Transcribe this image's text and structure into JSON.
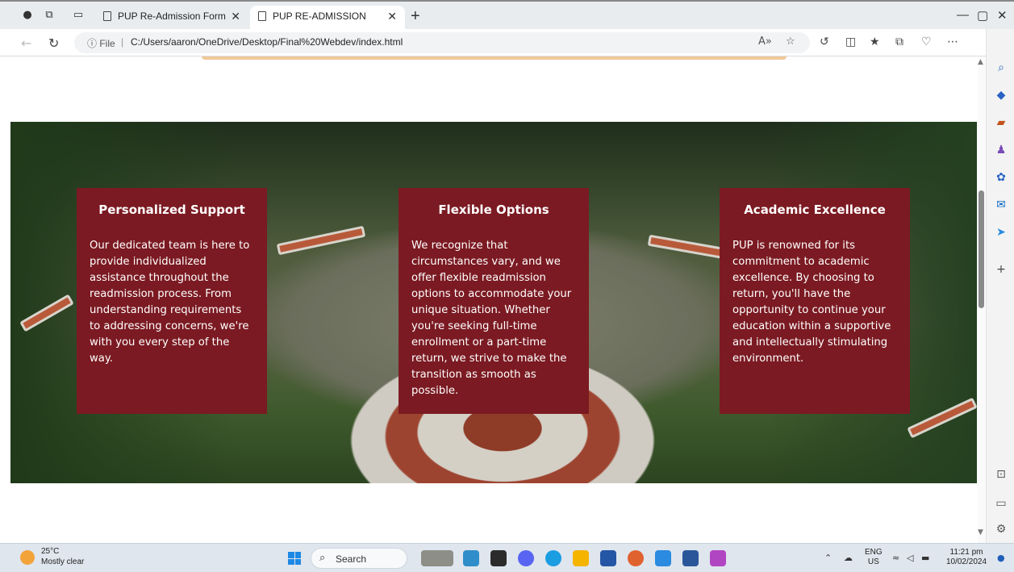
{
  "browser": {
    "tabs": [
      {
        "title": "PUP Re-Admission Form",
        "active": false
      },
      {
        "title": "PUP RE-ADMISSION",
        "active": true
      }
    ],
    "new_tab": "+",
    "address": {
      "info_label": "ⓘ File",
      "separator": "|",
      "url": "C:/Users/aaron/OneDrive/Desktop/Final%20Webdev/index.html"
    },
    "window_controls": {
      "minimize": "—",
      "restore": "▢",
      "close": "✕"
    }
  },
  "page": {
    "cards": [
      {
        "title": "Personalized Support",
        "body": "Our dedicated team is here to provide individualized assistance throughout the readmission process. From understanding requirements to addressing concerns, we're with you every step of the way."
      },
      {
        "title": "Flexible Options",
        "body": "We recognize that circumstances vary, and we offer flexible readmission options to accommodate your unique situation. Whether you're seeking full-time enrollment or a part-time return, we strive to make the transition as smooth as possible."
      },
      {
        "title": "Academic Excellence",
        "body": "PUP is renowned for its commitment to academic excellence. By choosing to return, you'll have the opportunity to continue your education within a supportive and intellectually stimulating environment."
      }
    ],
    "card_color": "#7b1a22"
  },
  "taskbar": {
    "weather": {
      "temp": "25°C",
      "condition": "Mostly clear"
    },
    "search_label": "Search",
    "language": {
      "lang": "ENG",
      "region": "US"
    },
    "clock": {
      "time": "11:21 pm",
      "date": "10/02/2024"
    }
  }
}
